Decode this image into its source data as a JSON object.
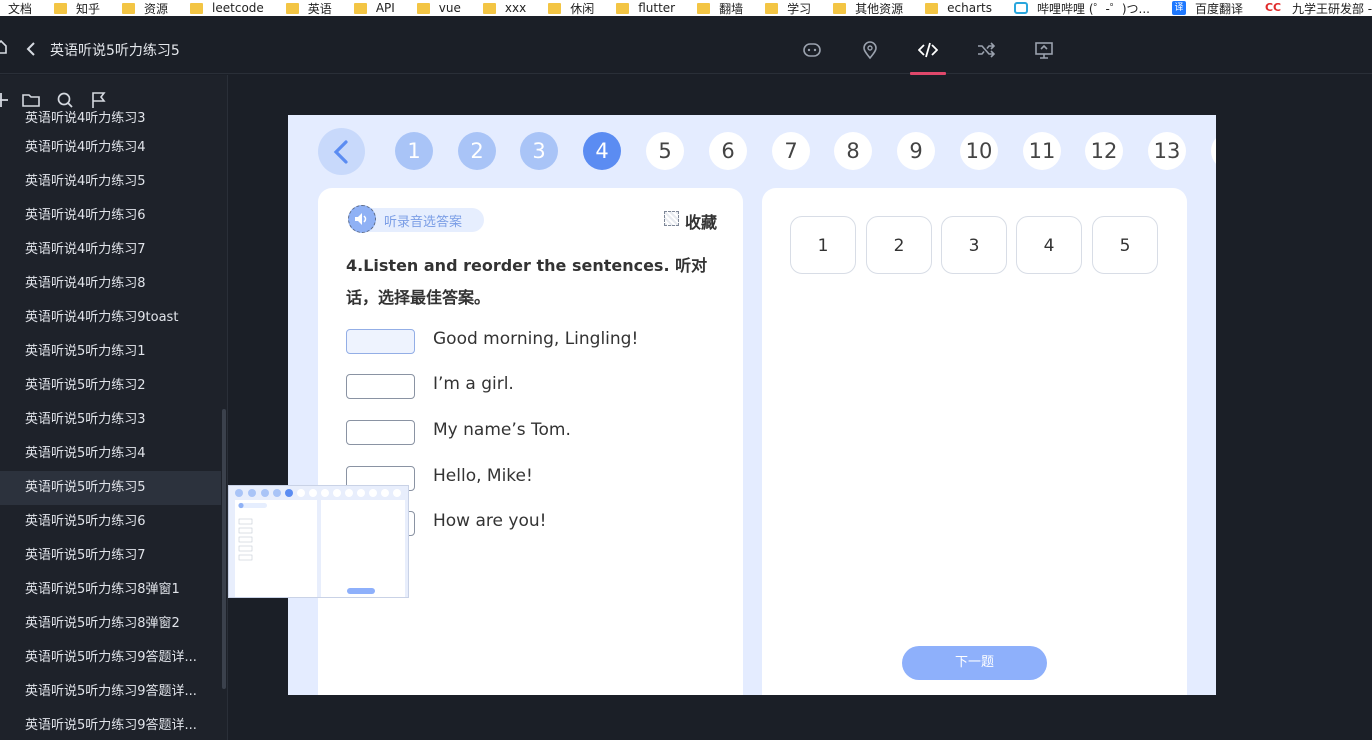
{
  "bookmarks": [
    {
      "label": "文档",
      "icon": "folder-icon"
    },
    {
      "label": "知乎",
      "icon": "folder-icon"
    },
    {
      "label": "资源",
      "icon": "folder-icon"
    },
    {
      "label": "leetcode",
      "icon": "folder-icon"
    },
    {
      "label": "英语",
      "icon": "folder-icon"
    },
    {
      "label": "API",
      "icon": "folder-icon"
    },
    {
      "label": "vue",
      "icon": "folder-icon"
    },
    {
      "label": "xxx",
      "icon": "folder-icon"
    },
    {
      "label": "休闲",
      "icon": "folder-icon"
    },
    {
      "label": "flutter",
      "icon": "folder-icon"
    },
    {
      "label": "翻墙",
      "icon": "folder-icon"
    },
    {
      "label": "学习",
      "icon": "folder-icon"
    },
    {
      "label": "其他资源",
      "icon": "folder-icon"
    },
    {
      "label": "echarts",
      "icon": "folder-icon"
    },
    {
      "label": "哔哩哔哩 (゜-゜)つ...",
      "icon": "bilibili-icon"
    },
    {
      "label": "百度翻译",
      "icon": "translate-icon"
    },
    {
      "label": "九学王研发部 - 幕客",
      "icon": "cc-icon"
    }
  ],
  "topnav": {
    "title": "英语听说5听力练习5",
    "icons": [
      "chat-icon",
      "location-pin-icon",
      "code-icon",
      "shuffle-icon",
      "board-icon"
    ],
    "active_icon": "code-icon",
    "accent": "#e0486b"
  },
  "sidebar": {
    "tools": [
      "add-icon",
      "folder-icon",
      "search-icon",
      "flag-icon"
    ],
    "items": [
      "英语听说4听力练习3",
      "英语听说4听力练习4",
      "英语听说4听力练习5",
      "英语听说4听力练习6",
      "英语听说4听力练习7",
      "英语听说4听力练习8",
      "英语听说4听力练习9toast",
      "英语听说5听力练习1",
      "英语听说5听力练习2",
      "英语听说5听力练习3",
      "英语听说5听力练习4",
      "英语听说5听力练习5",
      "英语听说5听力练习6",
      "英语听说5听力练习7",
      "英语听说5听力练习8弹窗1",
      "英语听说5听力练习8弹窗2",
      "英语听说5听力练习9答题详...",
      "英语听说5听力练习9答题详...",
      "英语听说5听力练习9答题详..."
    ],
    "active_index": 11
  },
  "canvas": {
    "question_numbers": [
      "1",
      "2",
      "3",
      "4",
      "5",
      "6",
      "7",
      "8",
      "9",
      "10",
      "11",
      "12",
      "13"
    ],
    "current_question": 4,
    "audio_label": "听录音选答案",
    "favorite_label": "收藏",
    "question_title": "4.Listen and reorder the sentences. 听对话，选择最佳答案。",
    "sentences": [
      "Good morning, Lingling!",
      "I’m a girl.",
      "My name’s Tom.",
      "Hello, Mike!",
      "How are you!"
    ],
    "answer_options": [
      "1",
      "2",
      "3",
      "4",
      "5"
    ],
    "next_button": "下一题",
    "colors": {
      "primary": "#5b8cf2",
      "done": "#a9c4f7",
      "canvas_bg": "#e4ecff",
      "button": "#8eb0fb"
    }
  },
  "thumbnail": {
    "title": "4.Listen and reorder the sentences. 听对话，选择最佳答案。",
    "sentences": [
      "Good morning, Lingling!",
      "I’m a girl.",
      "My name’s Tom.",
      "Hello, Mike!",
      "How are you!"
    ],
    "button": "下一题"
  }
}
